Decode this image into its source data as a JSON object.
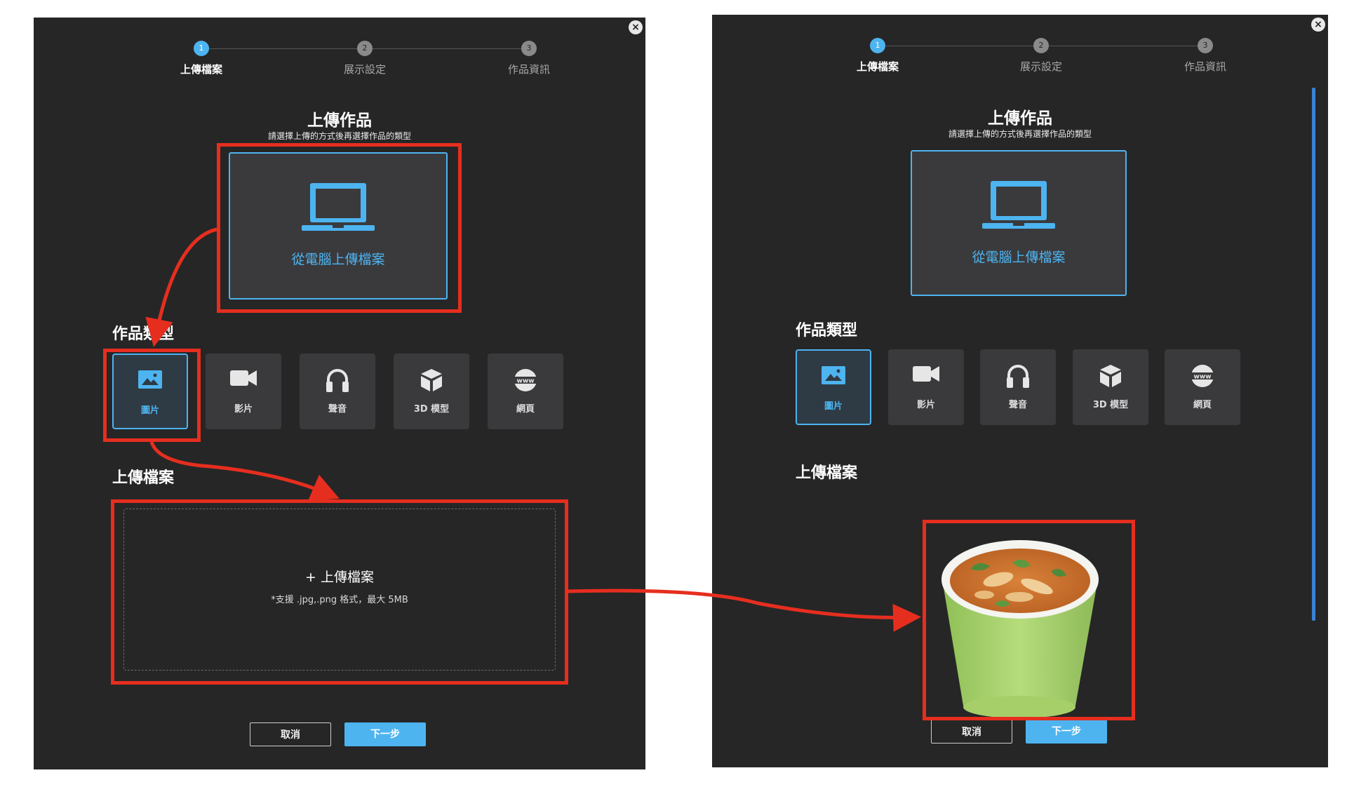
{
  "colors": {
    "accent": "#4db4f0",
    "annotation": "#e62e1f",
    "panel_bg": "#262626",
    "tile_bg": "#3a3a3d"
  },
  "steps": [
    {
      "num": "1",
      "label": "上傳檔案"
    },
    {
      "num": "2",
      "label": "展示設定"
    },
    {
      "num": "3",
      "label": "作品資訊"
    }
  ],
  "close_icon": "×",
  "upload_title": "上傳作品",
  "upload_subtitle": "請選擇上傳的方式後再選擇作品的類型",
  "computer_upload_label": "從電腦上傳檔案",
  "work_type_title": "作品類型",
  "work_types": [
    {
      "label": "圖片",
      "icon": "image-icon"
    },
    {
      "label": "影片",
      "icon": "video-camera-icon"
    },
    {
      "label": "聲音",
      "icon": "headphones-icon"
    },
    {
      "label": "3D 模型",
      "icon": "cube-icon"
    },
    {
      "label": "網頁",
      "icon": "www-globe-icon"
    }
  ],
  "upload_file_title": "上傳檔案",
  "dropzone": {
    "label": "+ 上傳檔案",
    "hint": "*支援 .jpg,.png 格式，最大 5MB"
  },
  "buttons": {
    "cancel": "取消",
    "next": "下一步"
  }
}
